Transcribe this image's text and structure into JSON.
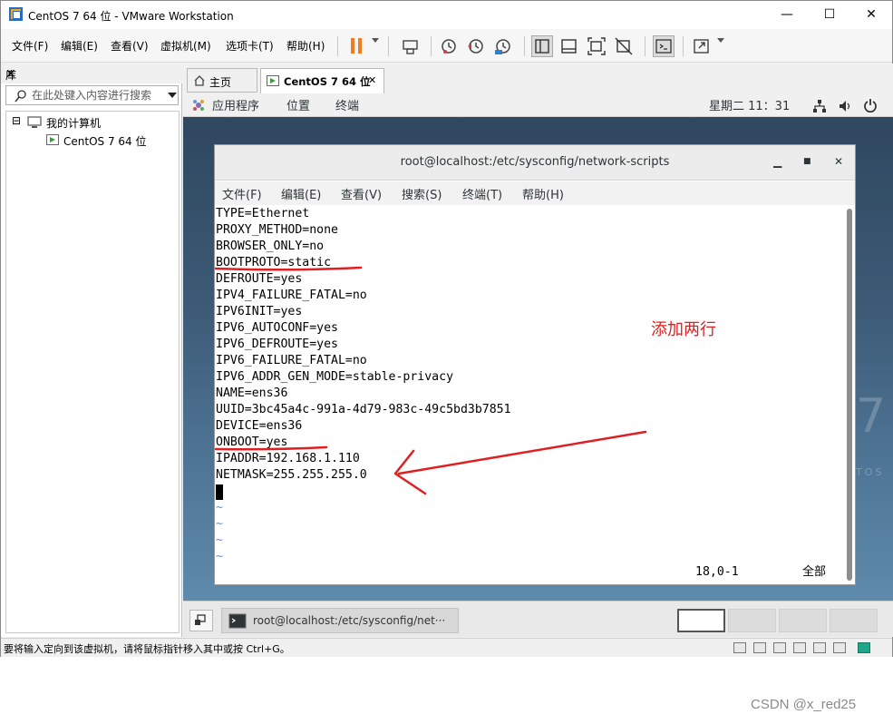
{
  "window": {
    "title": "CentOS 7 64 位 - VMware Workstation",
    "minimize": "—",
    "maximize": "☐",
    "close": "✕"
  },
  "menubar": {
    "items": [
      "文件(F)",
      "编辑(E)",
      "查看(V)",
      "虚拟机(M)",
      "选项卡(T)",
      "帮助(H)"
    ]
  },
  "toolbar": {
    "icons": [
      "pause-icon",
      "send-ctrl-alt-del-icon",
      "snapshot-icon",
      "revert-snapshot-icon",
      "snapshot-manager-icon",
      "normal-view-icon",
      "single-window-icon",
      "fullscreen-icon",
      "unity-icon",
      "console-icon",
      "stretch-icon"
    ]
  },
  "library": {
    "header": "库",
    "close": "✕",
    "search_placeholder": "在此处键入内容进行搜索",
    "tree": {
      "root": "我的计算机",
      "child": "CentOS 7 64 位",
      "expander": "⊟"
    }
  },
  "tabs": [
    {
      "label": "主页",
      "icon": "home-icon"
    },
    {
      "label": "CentOS 7 64 位",
      "icon": "vm-icon",
      "close": "✕"
    }
  ],
  "gnome": {
    "apps": "应用程序",
    "places": "位置",
    "terminal": "终端",
    "clock": "星期二 11：31"
  },
  "terminal": {
    "title": "root@localhost:/etc/sysconfig/network-scripts",
    "controls": [
      "▁",
      "■",
      "✕"
    ],
    "menu": [
      "文件(F)",
      "编辑(E)",
      "查看(V)",
      "搜索(S)",
      "终端(T)",
      "帮助(H)"
    ],
    "lines": [
      "TYPE=Ethernet",
      "PROXY_METHOD=none",
      "BROWSER_ONLY=no",
      "BOOTPROTO=static",
      "DEFROUTE=yes",
      "IPV4_FAILURE_FATAL=no",
      "IPV6INIT=yes",
      "IPV6_AUTOCONF=yes",
      "IPV6_DEFROUTE=yes",
      "IPV6_FAILURE_FATAL=no",
      "IPV6_ADDR_GEN_MODE=stable-privacy",
      "NAME=ens36",
      "UUID=3bc45a4c-991a-4d79-983c-49c5bd3b7851",
      "DEVICE=ens36",
      "ONBOOT=yes",
      "IPADDR=192.168.1.110",
      "NETMASK=255.255.255.0"
    ],
    "tildes": [
      "~",
      "~",
      "~",
      "~"
    ],
    "status_position": "18,0-1",
    "status_all": "全部"
  },
  "desktop": {
    "watermark_digit": "7",
    "watermark_text": "TOS"
  },
  "taskbar": {
    "task": "root@localhost:/etc/sysconfig/net···"
  },
  "statusbar": {
    "message": "要将输入定向到该虚拟机，请将鼠标指针移入其中或按 Ctrl+G。"
  },
  "annotation": {
    "text": "添加两行",
    "color": "#e02020"
  },
  "credit": "CSDN @x_red25"
}
